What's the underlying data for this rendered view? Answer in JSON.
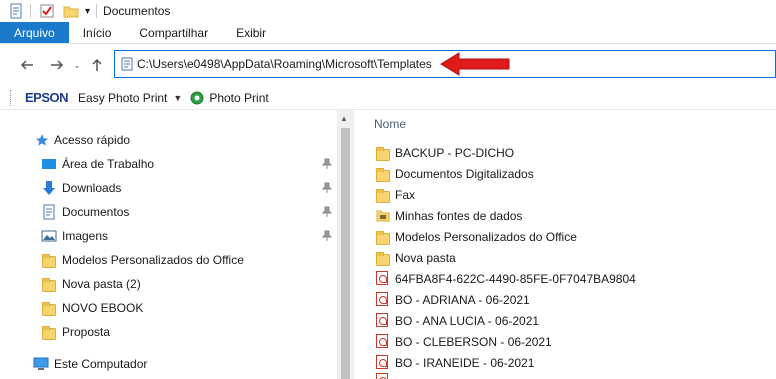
{
  "window": {
    "title": "Documentos"
  },
  "ribbon": {
    "tabs": [
      "Arquivo",
      "Início",
      "Compartilhar",
      "Exibir"
    ]
  },
  "address": {
    "path": "C:\\Users\\e0498\\AppData\\Roaming\\Microsoft\\Templates"
  },
  "epson_toolbar": {
    "brand": "EPSON",
    "easy_photo_print": "Easy Photo Print",
    "photo_print": "Photo Print"
  },
  "nav": {
    "quick_access": "Acesso rápido",
    "items": [
      {
        "label": "Área de Trabalho",
        "icon": "desktop-icon",
        "pinned": true
      },
      {
        "label": "Downloads",
        "icon": "download-arrow-icon",
        "pinned": true
      },
      {
        "label": "Documentos",
        "icon": "document-icon",
        "pinned": true
      },
      {
        "label": "Imagens",
        "icon": "pictures-icon",
        "pinned": true
      },
      {
        "label": "Modelos Personalizados do Office",
        "icon": "folder-icon",
        "pinned": false
      },
      {
        "label": "Nova pasta (2)",
        "icon": "folder-icon",
        "pinned": false
      },
      {
        "label": "NOVO EBOOK",
        "icon": "folder-icon",
        "pinned": false
      },
      {
        "label": "Proposta",
        "icon": "folder-icon",
        "pinned": false
      }
    ],
    "this_pc": "Este Computador"
  },
  "content": {
    "column_header": "Nome",
    "files": [
      {
        "name": "BACKUP - PC-DICHO",
        "type": "folder"
      },
      {
        "name": "Documentos Digitalizados",
        "type": "folder"
      },
      {
        "name": "Fax",
        "type": "folder"
      },
      {
        "name": "Minhas fontes de dados",
        "type": "datasource-folder"
      },
      {
        "name": "Modelos Personalizados do Office",
        "type": "folder"
      },
      {
        "name": "Nova pasta",
        "type": "folder"
      },
      {
        "name": "64FBA8F4-622C-4490-85FE-0F7047BA9804",
        "type": "pdf"
      },
      {
        "name": "BO - ADRIANA - 06-2021",
        "type": "pdf"
      },
      {
        "name": "BO - ANA LUCIA - 06-2021",
        "type": "pdf"
      },
      {
        "name": "BO - CLEBERSON - 06-2021",
        "type": "pdf"
      },
      {
        "name": "BO - IRANEIDE - 06-2021",
        "type": "pdf"
      }
    ]
  },
  "colors": {
    "accent": "#1979ca",
    "arrow": "#e01a1a",
    "folder": "#f7d470"
  }
}
